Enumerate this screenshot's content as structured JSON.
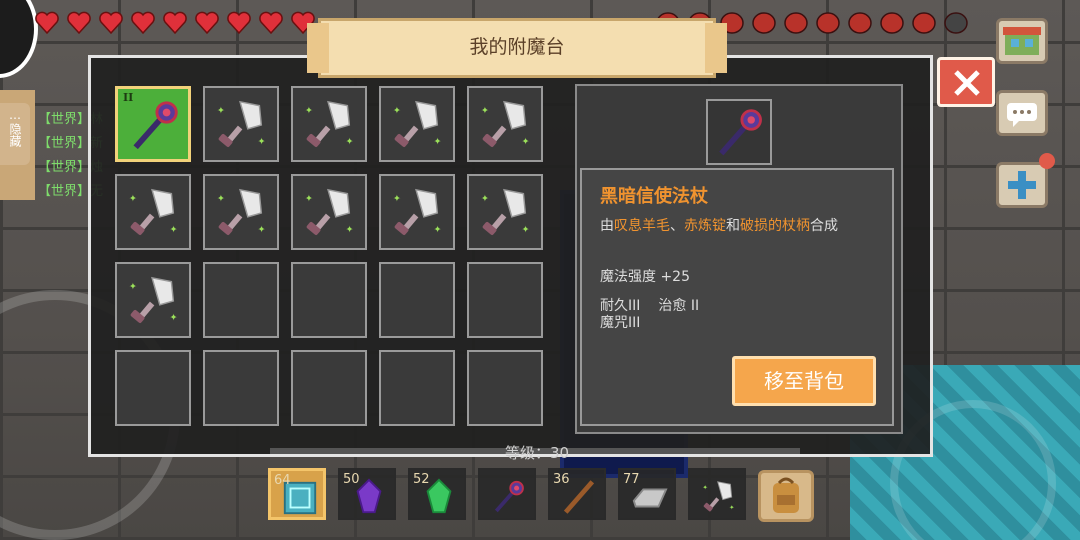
{
  "title": "我的附魔台",
  "chat": {
    "hide_label": "隐藏",
    "lines": [
      "【世界】林",
      "【世界】新",
      "【世界】烛",
      "【世界】无"
    ]
  },
  "grid": {
    "rows": [
      [
        {
          "item": "staff",
          "selected": true,
          "badge": "II"
        },
        {
          "item": "shovel"
        },
        {
          "item": "shovel"
        },
        {
          "item": "shovel"
        },
        {
          "item": "shovel"
        }
      ],
      [
        {
          "item": "shovel"
        },
        {
          "item": "shovel"
        },
        {
          "item": "shovel"
        },
        {
          "item": "shovel"
        },
        {
          "item": "shovel"
        }
      ],
      [
        {
          "item": "shovel"
        },
        {
          "item": "empty"
        },
        {
          "item": "empty"
        },
        {
          "item": "empty"
        },
        {
          "item": "empty"
        }
      ],
      [
        {
          "item": "empty"
        },
        {
          "item": "empty"
        },
        {
          "item": "empty"
        },
        {
          "item": "empty"
        },
        {
          "item": "empty"
        }
      ]
    ]
  },
  "detail": {
    "name": "黑暗信使法杖",
    "desc_prefix": "由",
    "ingredient1": "叹息羊毛",
    "sep1": "、",
    "ingredient2": "赤炼锭",
    "sep2": "和",
    "ingredient3": "破损的杖柄",
    "desc_suffix": "合成",
    "stat": "魔法强度 +25",
    "ench1": "耐久III",
    "ench2": "治愈 II",
    "ench3": "魔咒III",
    "move_button": "移至背包"
  },
  "level_text": "等级：30",
  "hotbar": [
    {
      "count": "64",
      "item": "cyan-block",
      "active": true
    },
    {
      "count": "50",
      "item": "purple-crystal"
    },
    {
      "count": "52",
      "item": "green-crystal"
    },
    {
      "count": "",
      "item": "staff"
    },
    {
      "count": "36",
      "item": "stick"
    },
    {
      "count": "77",
      "item": "iron-ingot"
    },
    {
      "count": "",
      "item": "shovel"
    }
  ],
  "colors": {
    "accent": "#f0932f",
    "panel": "#202020",
    "selected_slot": "#4caf3a",
    "button": "#f5a64c",
    "close": "#e05a4a"
  },
  "hud": {
    "hearts": 9,
    "food": 10
  }
}
